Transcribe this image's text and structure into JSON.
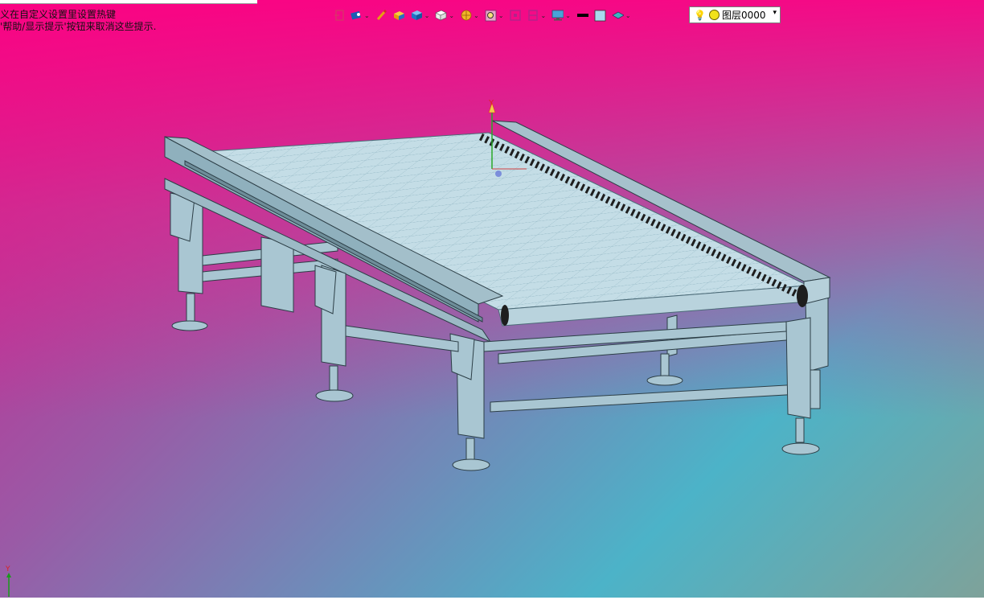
{
  "hints": [
    "义在自定义设置里设置热键",
    "'帮助/显示提示'按钮来取消这些提示."
  ],
  "toolbar": {
    "items": [
      {
        "icon": "view-door-icon",
        "has_dropdown": false
      },
      {
        "icon": "view-eye-icon",
        "has_dropdown": true
      },
      {
        "icon": "pencil-icon",
        "has_dropdown": false
      },
      {
        "icon": "yellow-box-icon",
        "has_dropdown": false
      },
      {
        "icon": "blue-cube-icon",
        "has_dropdown": true
      },
      {
        "icon": "white-cube-icon",
        "has_dropdown": true
      },
      {
        "icon": "render-sphere-icon",
        "has_dropdown": true
      },
      {
        "icon": "zoom-icon",
        "has_dropdown": true
      },
      {
        "icon": "snap-grid-icon",
        "has_dropdown": false
      },
      {
        "icon": "section-icon",
        "has_dropdown": true
      },
      {
        "icon": "monitor-icon",
        "has_dropdown": true
      },
      {
        "icon": "line-color-icon",
        "has_dropdown": false
      },
      {
        "icon": "fill-color-icon",
        "has_dropdown": false
      },
      {
        "icon": "layer-stack-icon",
        "has_dropdown": true
      }
    ],
    "dropdown_glyph": "⌄"
  },
  "layer_select": {
    "value": "图层0000",
    "arrow": "▾"
  },
  "axis": {
    "label": "Y"
  },
  "colors": {
    "background_top": "#ff0a8a",
    "background_bottom_left": "#2fd8e4",
    "frame_steel": "#a9c6d2",
    "belt": "#c4dde6",
    "chain": "#222222"
  }
}
